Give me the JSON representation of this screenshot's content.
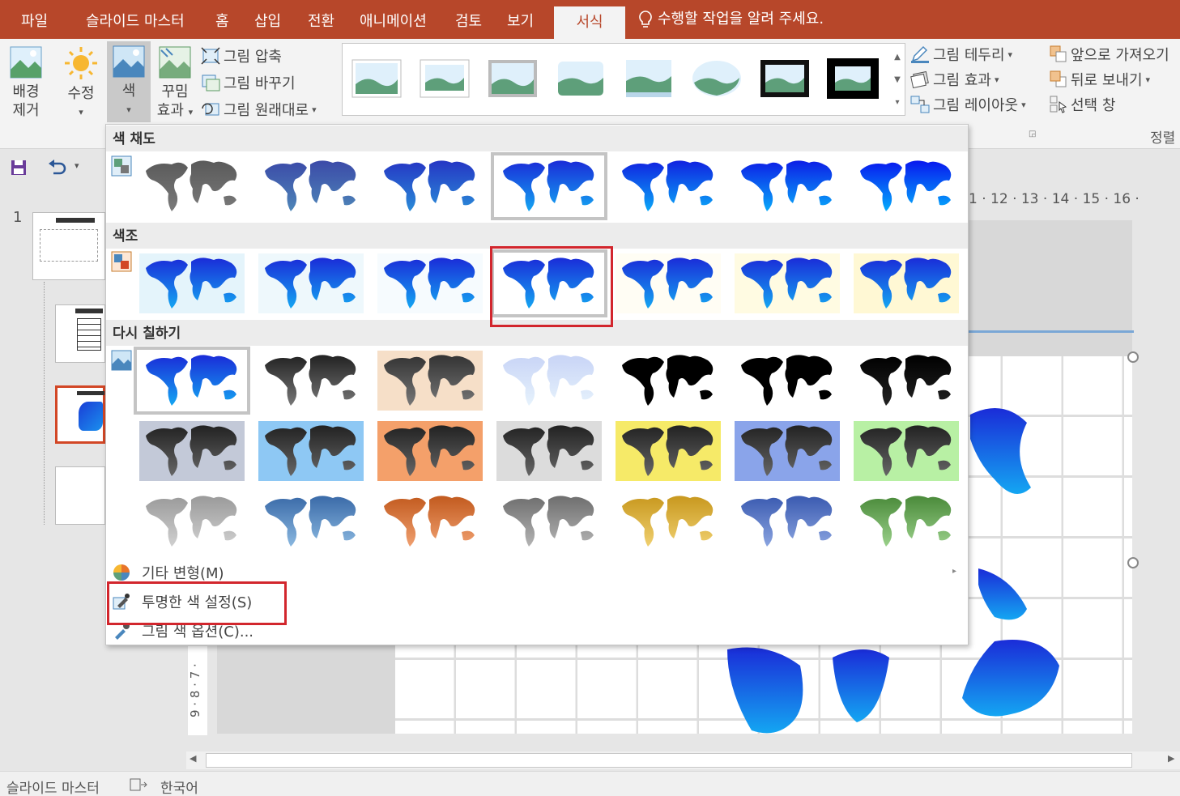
{
  "tabs": [
    {
      "label": "파일"
    },
    {
      "label": "슬라이드 마스터"
    },
    {
      "label": "홈"
    },
    {
      "label": "삽입"
    },
    {
      "label": "전환"
    },
    {
      "label": "애니메이션"
    },
    {
      "label": "검토"
    },
    {
      "label": "보기"
    },
    {
      "label": "서식"
    }
  ],
  "tell_me": "수행할 작업을 알려 주세요.",
  "ribbon": {
    "remove_bg": "배경\n제거",
    "remove_bg_1": "배경",
    "remove_bg_2": "제거",
    "corrections": "수정",
    "color": "색",
    "artistic_1": "꾸밈",
    "artistic_2": "효과",
    "compress": "그림 압축",
    "change": "그림 바꾸기",
    "reset": "그림 원래대로",
    "border": "그림 테두리",
    "effects": "그림 효과",
    "layout": "그림 레이아웃",
    "bring_forward": "앞으로 가져오기",
    "send_backward": "뒤로 보내기",
    "selection_pane": "선택 창",
    "arrange_group": "정렬"
  },
  "dropdown": {
    "saturation_header": "색 채도",
    "tone_header": "색조",
    "recolor_header": "다시 칠하기",
    "more_variations": "기타 변형(M)",
    "set_transparent": "투명한 색 설정(S)",
    "color_options": "그림 색 옵션(C)..."
  },
  "ruler": "1 · 12 · 13 · 14 · 15 · 16 ·",
  "vruler": "9 · 8 · 7 ·",
  "slide_number": "1",
  "status": {
    "mode": "슬라이드 마스터",
    "language": "한국어"
  },
  "colors": {
    "accent": "#b7472a",
    "highlight": "#d2262d"
  }
}
